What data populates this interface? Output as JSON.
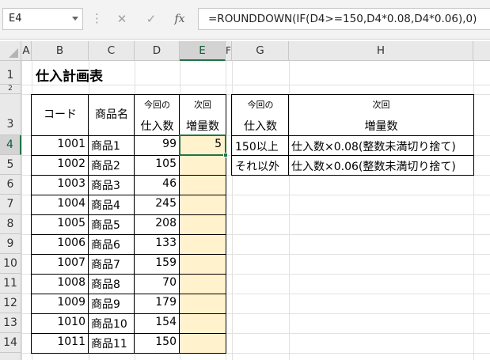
{
  "formula_bar": {
    "name_box": "E4",
    "formula": "=ROUNDDOWN(IF(D4>=150,D4*0.08,D4*0.06),0)"
  },
  "columns": [
    "A",
    "B",
    "C",
    "D",
    "E",
    "F",
    "G",
    "H"
  ],
  "rows": [
    "1",
    "2",
    "3",
    "4",
    "5",
    "6",
    "7",
    "8",
    "9",
    "10",
    "11",
    "12",
    "13",
    "14"
  ],
  "title": "仕入計画表",
  "table_header": {
    "code": "コード",
    "name": "商品名",
    "current_top": "今回の",
    "current_bottom": "仕入数",
    "next_top": "次回",
    "next_bottom": "増量数"
  },
  "items": [
    {
      "code": "1001",
      "name": "商品1",
      "qty": "99",
      "inc": "5"
    },
    {
      "code": "1002",
      "name": "商品2",
      "qty": "105",
      "inc": ""
    },
    {
      "code": "1003",
      "name": "商品3",
      "qty": "46",
      "inc": ""
    },
    {
      "code": "1004",
      "name": "商品4",
      "qty": "245",
      "inc": ""
    },
    {
      "code": "1005",
      "name": "商品5",
      "qty": "208",
      "inc": ""
    },
    {
      "code": "1006",
      "name": "商品6",
      "qty": "133",
      "inc": ""
    },
    {
      "code": "1007",
      "name": "商品7",
      "qty": "159",
      "inc": ""
    },
    {
      "code": "1008",
      "name": "商品8",
      "qty": "70",
      "inc": ""
    },
    {
      "code": "1009",
      "name": "商品9",
      "qty": "179",
      "inc": ""
    },
    {
      "code": "1010",
      "name": "商品10",
      "qty": "154",
      "inc": ""
    },
    {
      "code": "1011",
      "name": "商品11",
      "qty": "150",
      "inc": ""
    }
  ],
  "rule_table": {
    "hdr_left_top": "今回の",
    "hdr_left_bottom": "仕入数",
    "hdr_right_top": "次回",
    "hdr_right_bottom": "増量数",
    "rules": [
      {
        "condition": "150以上",
        "result": "仕入数×0.08(整数未満切り捨て)"
      },
      {
        "condition": "それ以外",
        "result": "仕入数×0.06(整数未満切り捨て)"
      }
    ]
  },
  "colors": {
    "fill_highlight": "#fff2cc",
    "selection": "#217346"
  }
}
